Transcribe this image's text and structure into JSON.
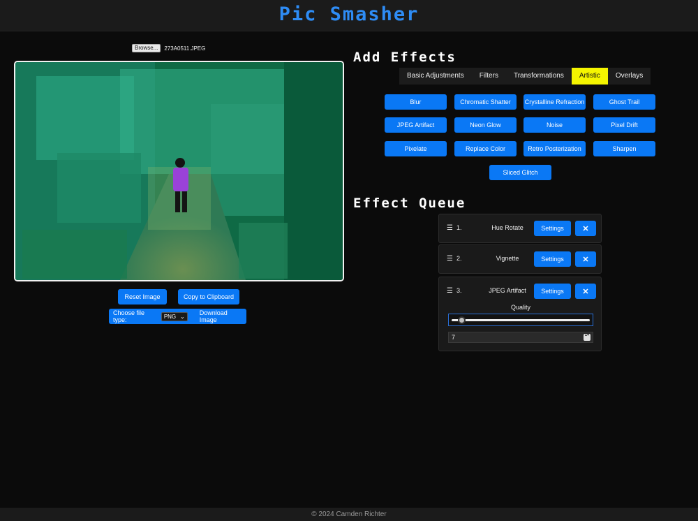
{
  "app": {
    "title": "Pic Smasher"
  },
  "upload": {
    "browse_label": "Browse...",
    "file_name": "273A0511.JPEG"
  },
  "preview": {
    "alt": "Image preview"
  },
  "actions": {
    "reset_label": "Reset Image",
    "copy_label": "Copy to Clipboard",
    "file_type_label": "Choose file type:",
    "file_type_value": "PNG",
    "download_label": "Download Image"
  },
  "effects_section": {
    "heading": "Add Effects",
    "tabs": [
      {
        "label": "Basic Adjustments",
        "active": false
      },
      {
        "label": "Filters",
        "active": false
      },
      {
        "label": "Transformations",
        "active": false
      },
      {
        "label": "Artistic",
        "active": true
      },
      {
        "label": "Overlays",
        "active": false
      }
    ],
    "buttons": [
      "Blur",
      "Chromatic Shatter",
      "Crystalline Refraction",
      "Ghost Trail",
      "JPEG Artifact",
      "Neon Glow",
      "Noise",
      "Pixel Drift",
      "Pixelate",
      "Replace Color",
      "Retro Posterization",
      "Sharpen",
      "Sliced Glitch"
    ]
  },
  "queue_section": {
    "heading": "Effect Queue",
    "items": [
      {
        "index": "1.",
        "name": "Hue Rotate",
        "settings_label": "Settings",
        "remove_label": "✕"
      },
      {
        "index": "2.",
        "name": "Vignette",
        "settings_label": "Settings",
        "remove_label": "✕"
      },
      {
        "index": "3.",
        "name": "JPEG Artifact",
        "settings_label": "Settings",
        "remove_label": "✕",
        "param_label": "Quality",
        "param_value": "7",
        "param_fraction": 0.05
      }
    ]
  },
  "footer": {
    "text": "© 2024 Camden Richter"
  },
  "colors": {
    "accent": "#0a78f5",
    "title": "#2e8cf5",
    "active_tab": "#f5f500",
    "background": "#0b0b0b"
  }
}
